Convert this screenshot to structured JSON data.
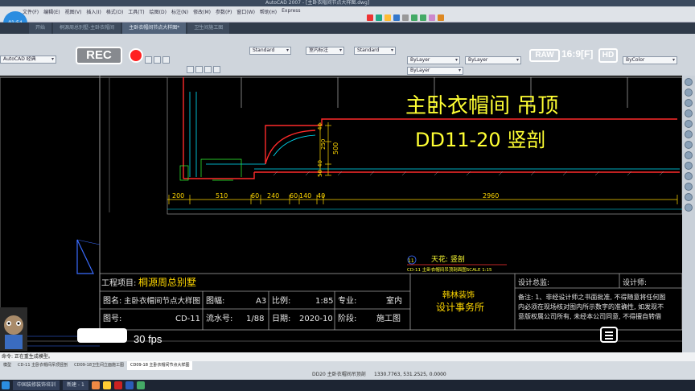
{
  "window": {
    "title": "AutoCAD 2007 - [主卧衣帽间节点大样图.dwg]",
    "menu": [
      "文件(F)",
      "编辑(E)",
      "视图(V)",
      "插入(I)",
      "格式(O)",
      "工具(T)",
      "绘图(D)",
      "标注(N)",
      "修改(M)",
      "参数(P)",
      "窗口(W)",
      "帮助(H)",
      "Express"
    ],
    "timer": "01:54"
  },
  "doc_tabs": [
    "开始",
    "桐源周总别墅-主卧衣帽间",
    "主卧衣帽间节点大样图*",
    "卫生间施工图"
  ],
  "ribbon": {
    "workspace": "AutoCAD 经典",
    "text_style": "Standard",
    "dim_style": "室内标注",
    "table_style": "Standard",
    "layer_color": "ByLayer",
    "linetype": "ByLayer",
    "lineweight": "ByLayer",
    "plot_style": "ByColor"
  },
  "recorder": {
    "rec_label": "REC",
    "raw_label": "RAW",
    "ratio_label": "16:9[F]",
    "hd_label": "HD",
    "fps_label": "30 fps"
  },
  "drawing": {
    "title_main": "主卧衣帽间 吊顶",
    "title_sub": "DD11-20  竖剖",
    "dims": [
      "200",
      "510",
      "60",
      "240",
      "60",
      "140",
      "40",
      "2960"
    ],
    "vdims": [
      "40",
      "250",
      "500",
      "40",
      "50"
    ],
    "callout_top": "天花: 竖剖",
    "callout_bottom": "CD-11  主卧衣帽间吊顶剖面图SCALE 1:15",
    "callout_num": "11"
  },
  "titleblock": {
    "project_label": "工程项目:",
    "project": "桐源周总别墅",
    "name_label": "图名:",
    "name": "主卧衣帽间节点大样图",
    "size_label": "图幅:",
    "size": "A3",
    "scale_label": "比例:",
    "scale": "1:85",
    "major_label": "专业:",
    "major": "室内",
    "no_label": "图号:",
    "no": "CD-11",
    "flow_label": "流水号:",
    "flow": "1/88",
    "date_label": "日期:",
    "date": "2020-10",
    "stage_label": "阶段:",
    "stage": "施工图",
    "company": "设计事务所",
    "company_brand": "韩林装饰",
    "director_label": "设计总监:",
    "designer_label": "设计师:",
    "notes": "备注: 1、非经设计师之书面批准, 不得随意将任何图",
    "notes2": "内必须在现场核对图内所示数字的准确性, 如发现不",
    "notes3": "意版权属公司所有, 未经本公司同意, 不得擅自转借"
  },
  "command": "命令: 正在重生成模型。",
  "layout_tabs": [
    "模型",
    "CD-11 主卧衣帽间吊顶竖剖",
    "CD09-18卫生间立面施工图",
    "CD09-18 主卧衣帽间节点大样图"
  ],
  "status": {
    "current": "DD20 主卧衣帽间吊顶剖",
    "coords": "1330.7763, 531.2525, 0.0000"
  },
  "taskbar": [
    "中国装修装饰培训",
    "新建 - 1"
  ],
  "colors": {
    "title_yellow": "#ffff33",
    "dim_yellow": "#ffd700",
    "red_line": "#ff2a2a",
    "cyan": "#00e5ff",
    "green": "#33ff33",
    "white": "#ffffff",
    "frame_gray": "#9a9a9a"
  }
}
